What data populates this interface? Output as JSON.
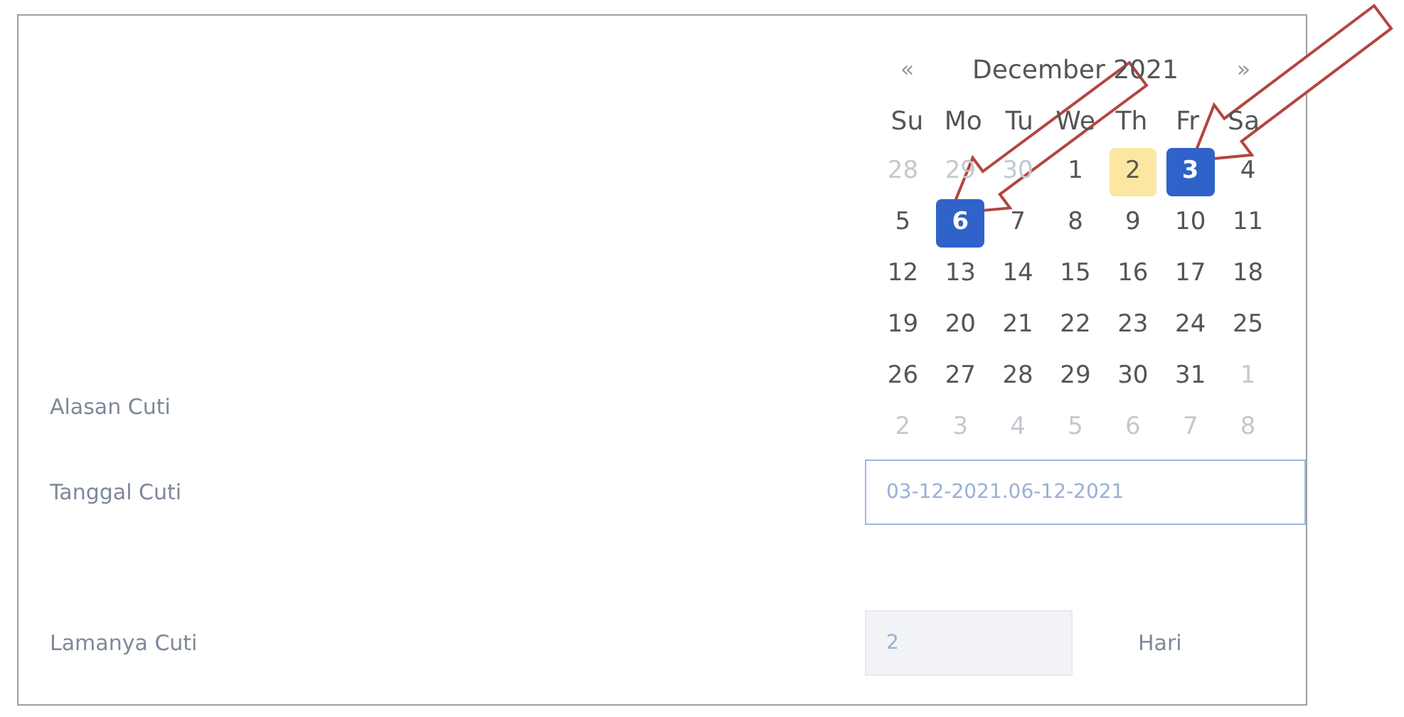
{
  "form": {
    "fields": [
      {
        "label": "Alasan Cuti"
      },
      {
        "label": "Tanggal Cuti",
        "value": "03-12-2021.06-12-2021"
      },
      {
        "label": "Lamanya Cuti",
        "value": "2",
        "unit": "Hari"
      }
    ]
  },
  "calendar": {
    "prev": "«",
    "title": "December 2021",
    "next": "»",
    "weekdays": [
      "Su",
      "Mo",
      "Tu",
      "We",
      "Th",
      "Fr",
      "Sa"
    ],
    "weeks": [
      [
        {
          "label": "28",
          "other_month": true,
          "selected": false,
          "today": false
        },
        {
          "label": "29",
          "other_month": true,
          "selected": false,
          "today": false
        },
        {
          "label": "30",
          "other_month": true,
          "selected": false,
          "today": false
        },
        {
          "label": "1",
          "other_month": false,
          "selected": false,
          "today": false
        },
        {
          "label": "2",
          "other_month": false,
          "selected": false,
          "today": true
        },
        {
          "label": "3",
          "other_month": false,
          "selected": true,
          "today": false
        },
        {
          "label": "4",
          "other_month": false,
          "selected": false,
          "today": false
        }
      ],
      [
        {
          "label": "5",
          "other_month": false,
          "selected": false,
          "today": false
        },
        {
          "label": "6",
          "other_month": false,
          "selected": true,
          "today": false
        },
        {
          "label": "7",
          "other_month": false,
          "selected": false,
          "today": false
        },
        {
          "label": "8",
          "other_month": false,
          "selected": false,
          "today": false
        },
        {
          "label": "9",
          "other_month": false,
          "selected": false,
          "today": false
        },
        {
          "label": "10",
          "other_month": false,
          "selected": false,
          "today": false
        },
        {
          "label": "11",
          "other_month": false,
          "selected": false,
          "today": false
        }
      ],
      [
        {
          "label": "12",
          "other_month": false,
          "selected": false,
          "today": false
        },
        {
          "label": "13",
          "other_month": false,
          "selected": false,
          "today": false
        },
        {
          "label": "14",
          "other_month": false,
          "selected": false,
          "today": false
        },
        {
          "label": "15",
          "other_month": false,
          "selected": false,
          "today": false
        },
        {
          "label": "16",
          "other_month": false,
          "selected": false,
          "today": false
        },
        {
          "label": "17",
          "other_month": false,
          "selected": false,
          "today": false
        },
        {
          "label": "18",
          "other_month": false,
          "selected": false,
          "today": false
        }
      ],
      [
        {
          "label": "19",
          "other_month": false,
          "selected": false,
          "today": false
        },
        {
          "label": "20",
          "other_month": false,
          "selected": false,
          "today": false
        },
        {
          "label": "21",
          "other_month": false,
          "selected": false,
          "today": false
        },
        {
          "label": "22",
          "other_month": false,
          "selected": false,
          "today": false
        },
        {
          "label": "23",
          "other_month": false,
          "selected": false,
          "today": false
        },
        {
          "label": "24",
          "other_month": false,
          "selected": false,
          "today": false
        },
        {
          "label": "25",
          "other_month": false,
          "selected": false,
          "today": false
        }
      ],
      [
        {
          "label": "26",
          "other_month": false,
          "selected": false,
          "today": false
        },
        {
          "label": "27",
          "other_month": false,
          "selected": false,
          "today": false
        },
        {
          "label": "28",
          "other_month": false,
          "selected": false,
          "today": false
        },
        {
          "label": "29",
          "other_month": false,
          "selected": false,
          "today": false
        },
        {
          "label": "30",
          "other_month": false,
          "selected": false,
          "today": false
        },
        {
          "label": "31",
          "other_month": false,
          "selected": false,
          "today": false
        },
        {
          "label": "1",
          "other_month": true,
          "selected": false,
          "today": false
        }
      ],
      [
        {
          "label": "2",
          "other_month": true,
          "selected": false,
          "today": false
        },
        {
          "label": "3",
          "other_month": true,
          "selected": false,
          "today": false
        },
        {
          "label": "4",
          "other_month": true,
          "selected": false,
          "today": false
        },
        {
          "label": "5",
          "other_month": true,
          "selected": false,
          "today": false
        },
        {
          "label": "6",
          "other_month": true,
          "selected": false,
          "today": false
        },
        {
          "label": "7",
          "other_month": true,
          "selected": false,
          "today": false
        },
        {
          "label": "8",
          "other_month": true,
          "selected": false,
          "today": false
        }
      ]
    ]
  }
}
